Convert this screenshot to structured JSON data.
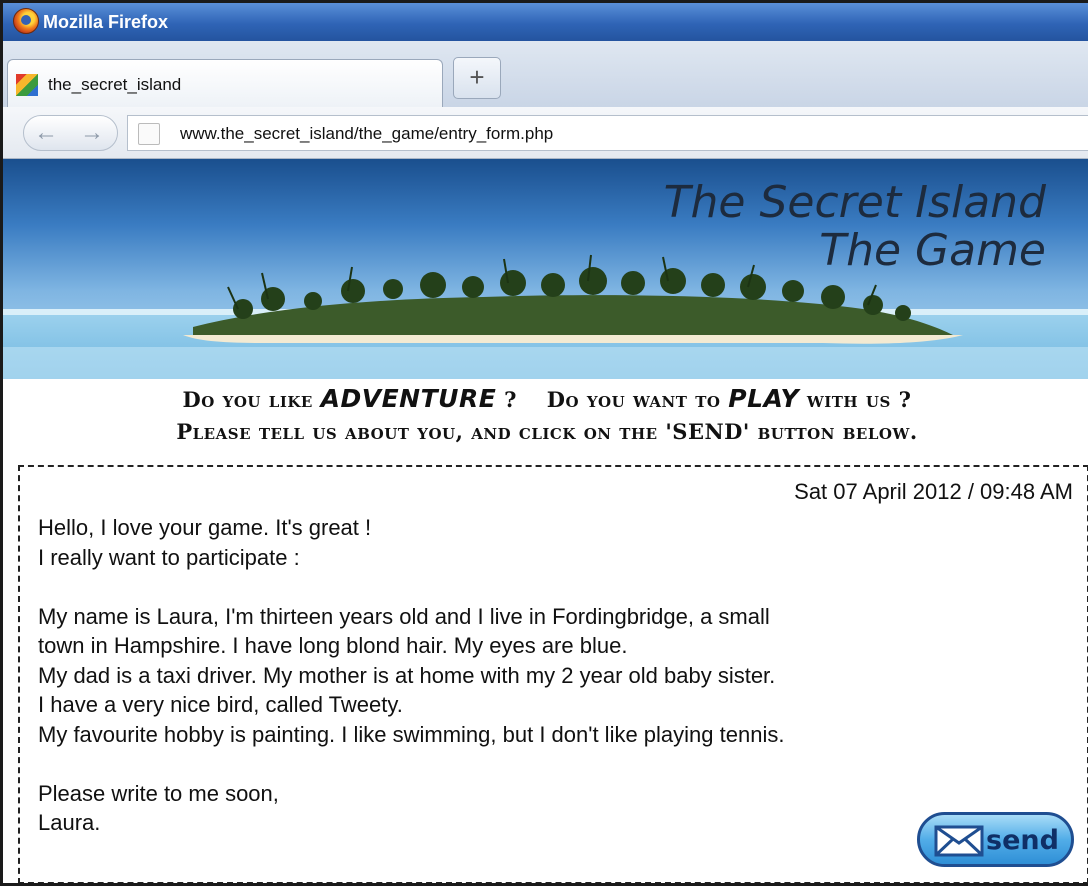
{
  "window": {
    "title": "Mozilla Firefox"
  },
  "tab": {
    "label": "the_secret_island",
    "new_tab_symbol": "+"
  },
  "urlbar": {
    "url": "www.the_secret_island/the_game/entry_form.php"
  },
  "banner": {
    "title_line1": "The Secret Island",
    "title_line2": "The Game"
  },
  "headings": {
    "line1_a": "Do you like",
    "line1_emph1": "ADVENTURE",
    "line1_b": "?",
    "line1_c": "Do you want to",
    "line1_emph2": "PLAY",
    "line1_d": "with us ?",
    "line2": "Please tell us about you, and click on the 'SEND' button below."
  },
  "form": {
    "date": "Sat  07 April 2012 / 09:48 AM",
    "lines": [
      "Hello, I love your game. It's great !",
      "I really want to participate :",
      "",
      "My name is Laura, I'm thirteen years old and I live in Fordingbridge, a small",
      "town in Hampshire. I have long blond hair. My eyes are blue.",
      "My dad is a taxi driver. My mother is at home with my 2 year old baby sister.",
      "I have a very nice bird, called Tweety.",
      "My favourite hobby is painting. I like swimming, but I don't like playing tennis.",
      "",
      "Please write to me soon,",
      "Laura."
    ],
    "send_label": "send"
  },
  "icons": {
    "browser": "firefox-logo-icon",
    "favicon": "site-favicon-icon",
    "back": "back-arrow-icon",
    "forward": "forward-arrow-icon",
    "page": "page-icon",
    "send": "envelope-icon"
  },
  "colors": {
    "titlebar": "#2f64b6",
    "send_button": "#52ade8",
    "send_text": "#0f2f66"
  }
}
